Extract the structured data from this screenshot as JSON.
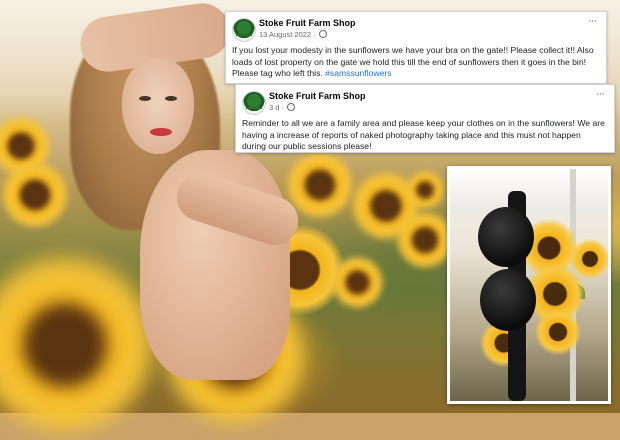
{
  "posts": [
    {
      "name": "Stoke Fruit Farm Shop",
      "date": "13 August 2022 ·",
      "body_text": "If you lost your modesty in the sunflowers we have your bra on the gate!! Please collect it!! Also loads of lost property on the gate we hold this till the end of sunflowers then it goes in the bin! Please tag who left this.",
      "hashtag": "#samssunflowers"
    },
    {
      "name": "Stoke Fruit Farm Shop",
      "date": "3 d ·",
      "body_text": "Reminder to all we are a family area and please keep your clothes on in the sunflowers! We are having a increase of reports of naked photography taking place and this must not happen during our public sessions please!"
    }
  ],
  "more_options_label": "···",
  "icons": {
    "avatar": "stoke-fruit-farm-logo",
    "privacy": "globe-icon"
  },
  "colors": {
    "post_bg": "#ffffff",
    "hashtag": "#216fdb",
    "meta": "#65676b"
  }
}
